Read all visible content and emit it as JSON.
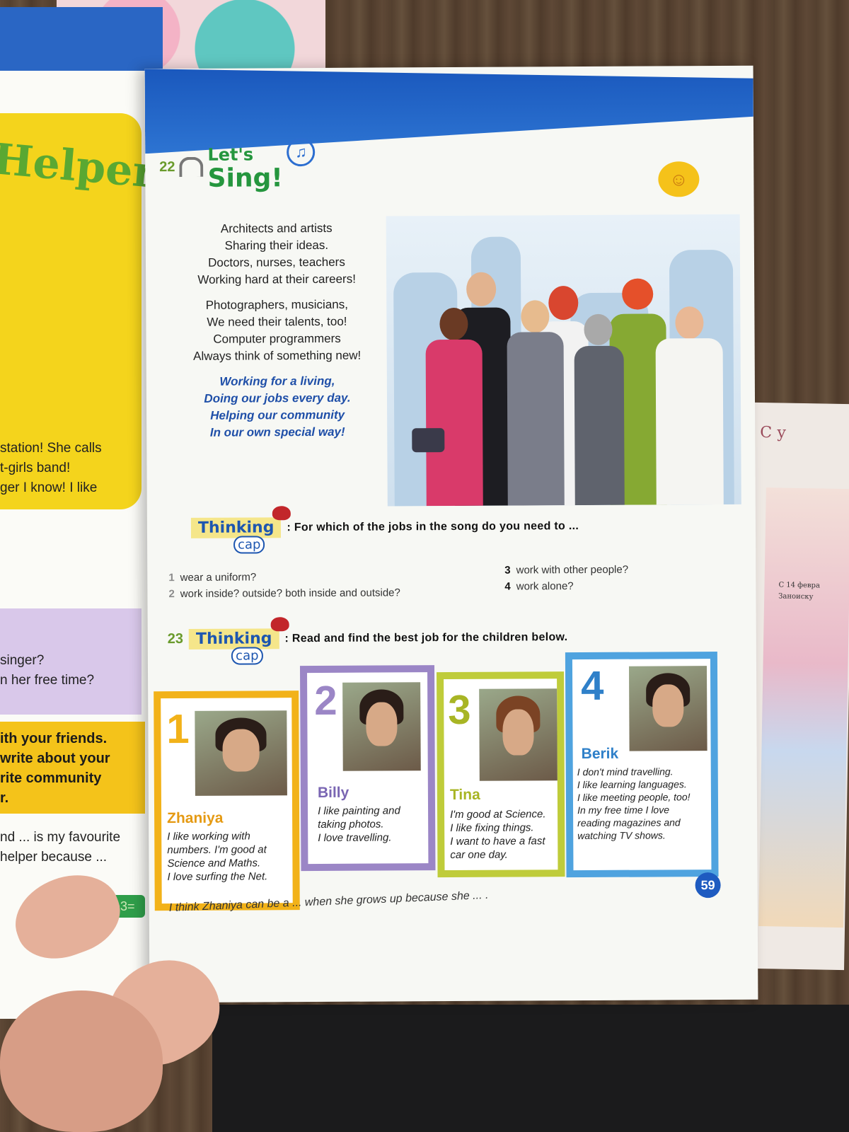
{
  "left_page": {
    "title_fragment": "Helper",
    "text_lines": [
      "station! She calls",
      "t-girls band!",
      "ger I know! I like"
    ],
    "questions": [
      "singer?",
      "n her free time?"
    ],
    "task_lines": [
      "ith your friends.",
      "write about your",
      "rite community",
      "r."
    ],
    "prompt_lines": [
      "nd ... is my favourite",
      "helper because ..."
    ],
    "math_badge": "25+3="
  },
  "song": {
    "number": "22",
    "title_line1": "Let's",
    "title_line2": "Sing!",
    "verse1": [
      "Architects and artists",
      "Sharing their ideas.",
      "Doctors, nurses, teachers",
      "Working hard at their careers!"
    ],
    "verse2": [
      "Photographers, musicians,",
      "We need their talents, too!",
      "Computer programmers",
      "Always think of something new!"
    ],
    "chorus": [
      "Working for a living,",
      "Doing our jobs every day.",
      "Helping our community",
      "In our own special way!"
    ]
  },
  "task22": {
    "logo": "Thinking",
    "logo_sub": "cap",
    "question": ": For which of the jobs in the song do you need to ...",
    "items_left": [
      {
        "n": "1",
        "text": "wear a uniform?"
      },
      {
        "n": "2",
        "text": "work inside? outside? both inside and outside?"
      }
    ],
    "items_right": [
      {
        "n": "3",
        "text": "work with other people?"
      },
      {
        "n": "4",
        "text": "work alone?"
      }
    ]
  },
  "task23": {
    "number": "23",
    "logo": "Thinking",
    "logo_sub": "cap",
    "instruction": ": Read and find the best job for the children below."
  },
  "cards": [
    {
      "n": "1",
      "name": "Zhaniya",
      "color": "#f2b219",
      "lines": [
        "I like working with",
        "numbers. I'm good at",
        "Science and Maths.",
        "I love surfing the Net."
      ]
    },
    {
      "n": "2",
      "name": "Billy",
      "color": "#9b86c6",
      "lines": [
        "I like painting and",
        "taking photos.",
        "I love travelling."
      ]
    },
    {
      "n": "3",
      "name": "Tina",
      "color": "#bfcc3a",
      "lines": [
        "I'm good at Science.",
        "I like fixing things.",
        "I want to have a fast",
        "car one day."
      ]
    },
    {
      "n": "4",
      "name": "Berik",
      "color": "#4fa3df",
      "lines": [
        "I don't mind travelling.",
        "I like learning languages.",
        "I like meeting people, too!",
        "In my free time I love",
        "reading magazines and",
        "watching TV shows."
      ]
    }
  ],
  "bottom_sentence": "I think Zhaniya can be a ... when she grows up because she ... .",
  "page_number": "59",
  "side_note": {
    "title": "С у",
    "lines": [
      "С 14 февра",
      "Заноиску"
    ]
  }
}
